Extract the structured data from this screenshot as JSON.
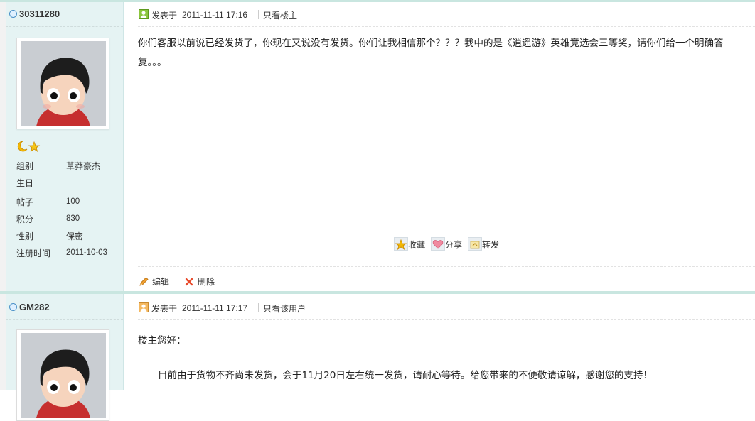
{
  "posts": [
    {
      "author": "30311280",
      "meta": {
        "posted_label": "发表于",
        "timestamp": "2011-11-11 17:16",
        "filter_link": "只看楼主"
      },
      "content": "你们客服以前说已经发货了，你现在又说没有发货。你们让我相信那个？？？我中的是《逍遥游》英雄竞选会三等奖，请你们给一个明确答复。。。",
      "profile": [
        {
          "label": "组别",
          "value": "草莽豪杰"
        },
        {
          "label": "生日",
          "value": ""
        },
        {
          "label": "帖子",
          "value": "100"
        },
        {
          "label": "积分",
          "value": "830"
        },
        {
          "label": "性别",
          "value": "保密"
        },
        {
          "label": "注册时间",
          "value": "2011-10-03"
        }
      ],
      "share": {
        "favorite": "收藏",
        "share": "分享",
        "forward": "转发"
      },
      "actions": {
        "edit": "编辑",
        "delete": "删除"
      }
    },
    {
      "author": "GM282",
      "meta": {
        "posted_label": "发表于",
        "timestamp": "2011-11-11 17:17",
        "filter_link": "只看该用户"
      },
      "greeting": "楼主您好：",
      "body": "目前由于货物不齐尚未发货，会于11月20日左右统一发货，请耐心等待。给您带来的不便敬请谅解，感谢您的支持！"
    }
  ],
  "colors": {
    "accent_border": "#c9e6e0",
    "sidebar_bg": "#e5f3f3",
    "star": "#f2b705",
    "delete_red": "#e84a2b",
    "edit_orange": "#f0a030"
  }
}
